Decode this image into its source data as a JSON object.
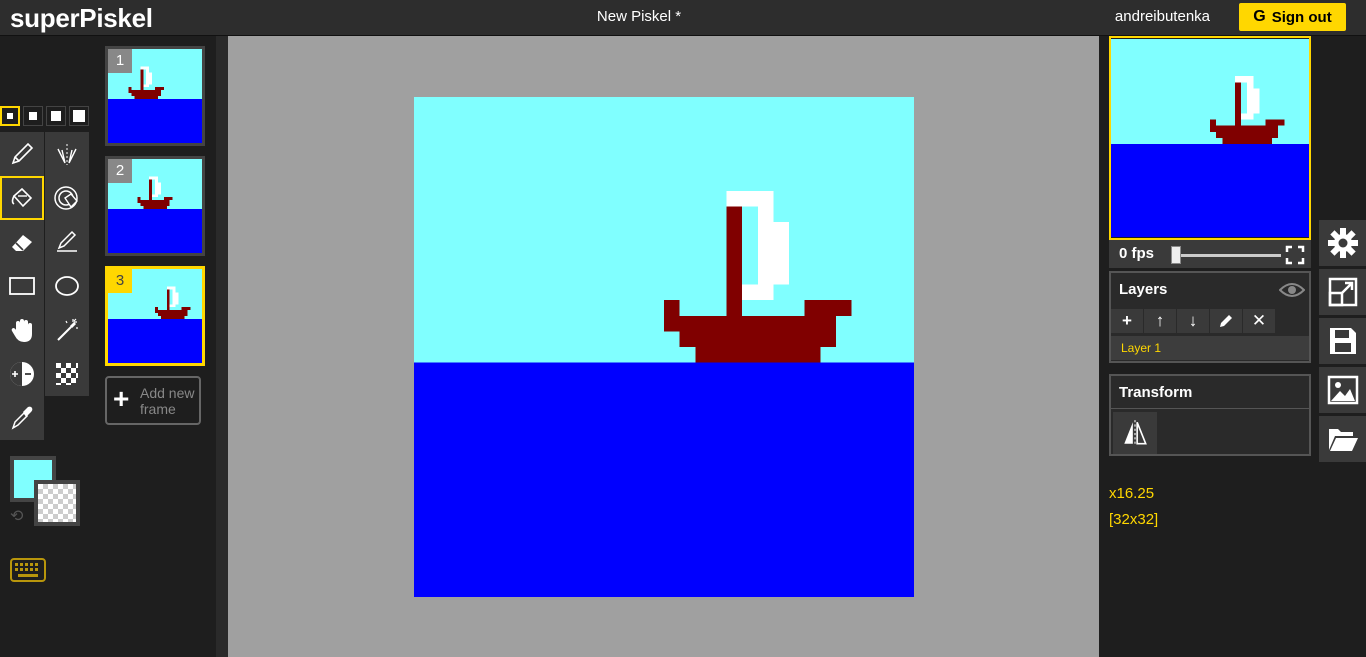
{
  "app": {
    "logo": "superPiskel",
    "document_title": "New Piskel *"
  },
  "user": {
    "name": "andreibutenka",
    "signout_label": "Sign out",
    "signout_glyph": "G"
  },
  "tools": {
    "pen_sizes": [
      1,
      2,
      3,
      4
    ],
    "selected_pen_size": 1,
    "items": [
      "pen",
      "vertical-mirror-pen",
      "paint-bucket",
      "paint-all-same-pixels",
      "eraser",
      "stroke",
      "rectangle",
      "circle",
      "move",
      "magic-wand",
      "lighten",
      "dithering",
      "color-picker"
    ],
    "active_tool": "paint-bucket",
    "primary_color": "#80ffff",
    "secondary_color": "transparent"
  },
  "frames": {
    "items": [
      {
        "number": "1"
      },
      {
        "number": "2"
      },
      {
        "number": "3"
      }
    ],
    "active_index": 2,
    "add_label": "Add new frame"
  },
  "preview": {
    "fps_label": "0 fps",
    "fps_value": 0
  },
  "layers": {
    "title": "Layers",
    "buttons": [
      "add",
      "move-up",
      "move-down",
      "rename",
      "delete"
    ],
    "items": [
      {
        "name": "Layer 1"
      }
    ]
  },
  "transform": {
    "title": "Transform"
  },
  "zoom": {
    "label": "x16.25"
  },
  "size": {
    "label": "[32x32]"
  },
  "colors": {
    "sky": "#80ffff",
    "sea": "#0000ff",
    "boat": "#800000",
    "sail": "#ffffff",
    "accent": "#ffd700"
  }
}
